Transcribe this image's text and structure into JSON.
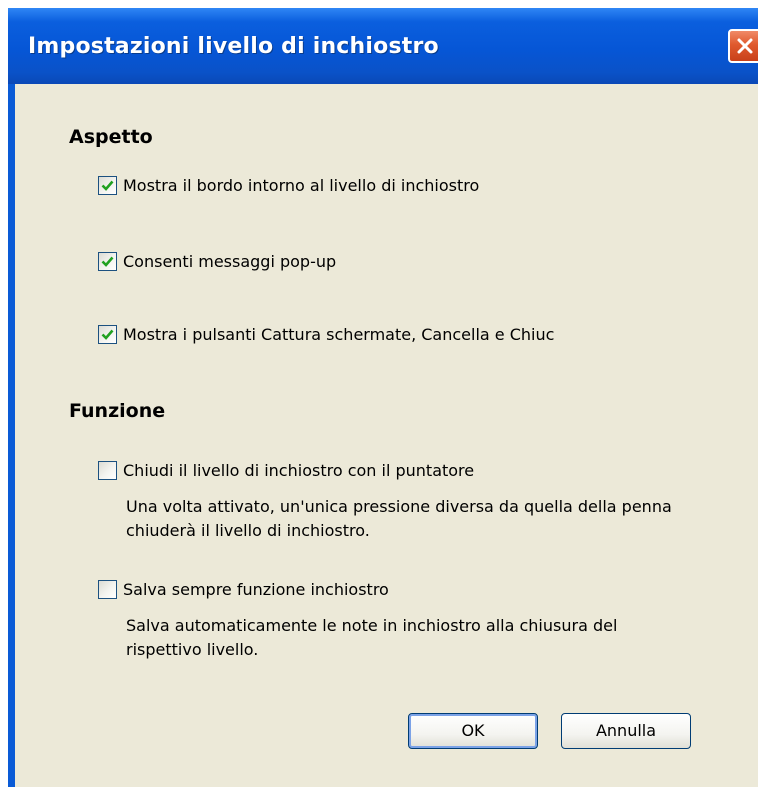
{
  "window": {
    "title": "Impostazioni livello di inchiostro",
    "close_icon": "close-icon"
  },
  "aspetto": {
    "heading": "Aspetto",
    "options": [
      {
        "label": "Mostra il bordo intorno al livello di inchiostro",
        "checked": true
      },
      {
        "label": "Consenti messaggi pop-up",
        "checked": true
      },
      {
        "label": "Mostra i pulsanti Cattura schermate, Cancella e Chiuc",
        "checked": true
      }
    ]
  },
  "funzione": {
    "heading": "Funzione",
    "options": [
      {
        "label": "Chiudi il livello di inchiostro con il puntatore",
        "checked": false,
        "desc_line1": "Una volta attivato, un'unica pressione diversa da quella della penna",
        "desc_line2": "chiuderà il livello di inchiostro."
      },
      {
        "label": "Salva sempre funzione inchiostro",
        "checked": false,
        "desc_line1": "Salva automaticamente le note in inchiostro alla chiusura del",
        "desc_line2": "rispettivo livello."
      }
    ]
  },
  "buttons": {
    "ok_label": "OK",
    "cancel_label": "Annulla"
  },
  "colors": {
    "titlebar": "#0656d6",
    "client_background": "#ece9d8",
    "check_mark": "#21a121",
    "close_button": "#e05a2e"
  }
}
